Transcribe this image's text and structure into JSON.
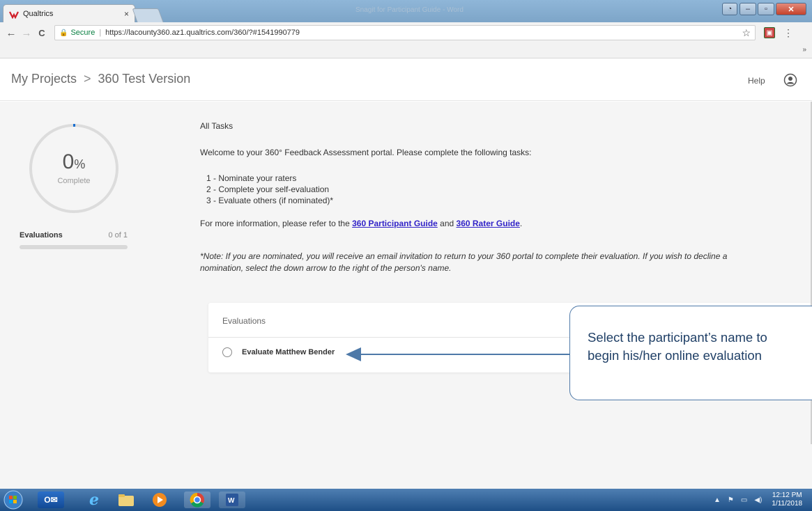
{
  "browser": {
    "tab_title": "Qualtrics",
    "tab_close": "×",
    "window_title": "Snagit for Participant Guide - Word",
    "url_secure_label": "Secure",
    "url": "https://lacounty360.az1.qualtrics.com/360/?#1541990779",
    "bookmarks_overflow": "»",
    "nav": {
      "back": "←",
      "forward": "→",
      "reload": "C"
    }
  },
  "header": {
    "breadcrumb": [
      "My Projects",
      "360 Test Version"
    ],
    "breadcrumb_separator": ">",
    "help_label": "Help"
  },
  "sidebar": {
    "progress_value": "0",
    "progress_unit": "%",
    "progress_label": "Complete",
    "progress_fraction": 0.0,
    "evaluations_label": "Evaluations",
    "evaluations_count": "0 of 1"
  },
  "main": {
    "section_title": "All Tasks",
    "welcome": "Welcome to your 360° Feedback Assessment portal. Please complete the following tasks:",
    "tasks": [
      "1 - Nominate your raters",
      "2 - Complete your self-evaluation",
      "3 - Evaluate others (if nominated)*"
    ],
    "info_prefix": "For more information, please refer to the ",
    "participant_guide_link": "360 Participant Guide",
    "info_and": " and ",
    "rater_guide_link": "360 Rater Guide",
    "info_suffix": ".",
    "note": "*Note: If you are nominated, you will receive an email invitation to return to your 360 portal to complete their evaluation. If you wish to decline a nomination, select the down arrow to the right of the person's name.",
    "evaluations_card": {
      "title": "Evaluations",
      "items": [
        {
          "label": "Evaluate Matthew Bender"
        }
      ]
    }
  },
  "callout": {
    "text": "Select the participant’s name to\nbegin his/her online evaluation"
  },
  "taskbar": {
    "clock_time": "12:12 PM",
    "clock_date": "1/11/2018"
  },
  "colors": {
    "link": "#3224c8",
    "progress_accent": "#1a6fd0",
    "callout_border": "#4e79a8",
    "callout_text": "#1f3f66"
  },
  "icons": {
    "favicon": "qualtrics-logo-icon",
    "lock": "lock-icon",
    "star": "star-icon",
    "user": "user-account-icon",
    "radio": "radio-button-icon"
  }
}
